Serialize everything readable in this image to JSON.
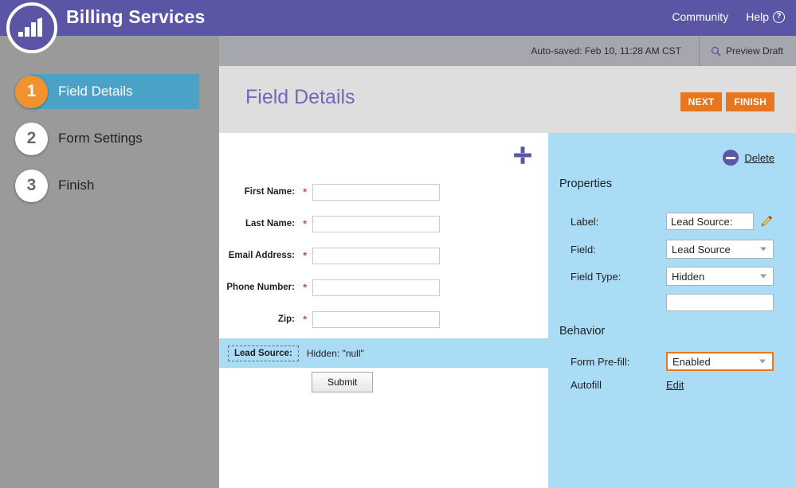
{
  "header": {
    "app_title": "Billing Services",
    "logo_icon": "bar-chart-circle-logo",
    "nav": [
      {
        "label": "Community",
        "icon": null
      },
      {
        "label": "Help",
        "icon": "question-mark-icon"
      }
    ],
    "brand_color": "#5b55a6"
  },
  "savebar": {
    "autosave_text": "Auto-saved: Feb 10, 11:28 AM CST",
    "preview_label": "Preview Draft",
    "preview_icon": "magnifier-icon"
  },
  "sidebar": {
    "steps": [
      {
        "num": "1",
        "label": "Field Details",
        "active": true
      },
      {
        "num": "2",
        "label": "Form Settings",
        "active": false
      },
      {
        "num": "3",
        "label": "Finish",
        "active": false
      }
    ],
    "active_color": "#4aa3c7",
    "active_num_color": "#f0932e"
  },
  "page": {
    "title": "Field Details",
    "next_label": "NEXT",
    "finish_label": "FINISH",
    "button_color": "#e8761d"
  },
  "canvas": {
    "add_icon": "plus-icon",
    "fields": [
      {
        "label": "First Name:",
        "required": "*",
        "value": ""
      },
      {
        "label": "Last Name:",
        "required": "*",
        "value": ""
      },
      {
        "label": "Email Address:",
        "required": "*",
        "value": ""
      },
      {
        "label": "Phone Number:",
        "required": "*",
        "value": ""
      },
      {
        "label": "Zip:",
        "required": "*",
        "value": ""
      }
    ],
    "selected_field": {
      "tag": "Lead Source:",
      "value_text": "Hidden: \"null\"",
      "highlight_color": "#aadcf5"
    },
    "submit_label": "Submit"
  },
  "properties": {
    "delete_label": "Delete",
    "delete_icon": "minus-circle-icon",
    "properties_heading": "Properties",
    "behavior_heading": "Behavior",
    "label_row": {
      "label": "Label:",
      "value": "Lead Source:",
      "edit_icon": "pencil-icon"
    },
    "field_row": {
      "label": "Field:",
      "value": "Lead Source"
    },
    "field_type_row": {
      "label": "Field Type:",
      "value": "Hidden"
    },
    "extra_input": {
      "value": ""
    },
    "prefill_row": {
      "label": "Form Pre-fill:",
      "value": "Enabled"
    },
    "autofill_row": {
      "label": "Autofill",
      "value": "Edit"
    },
    "panel_color": "#aadcf5"
  }
}
